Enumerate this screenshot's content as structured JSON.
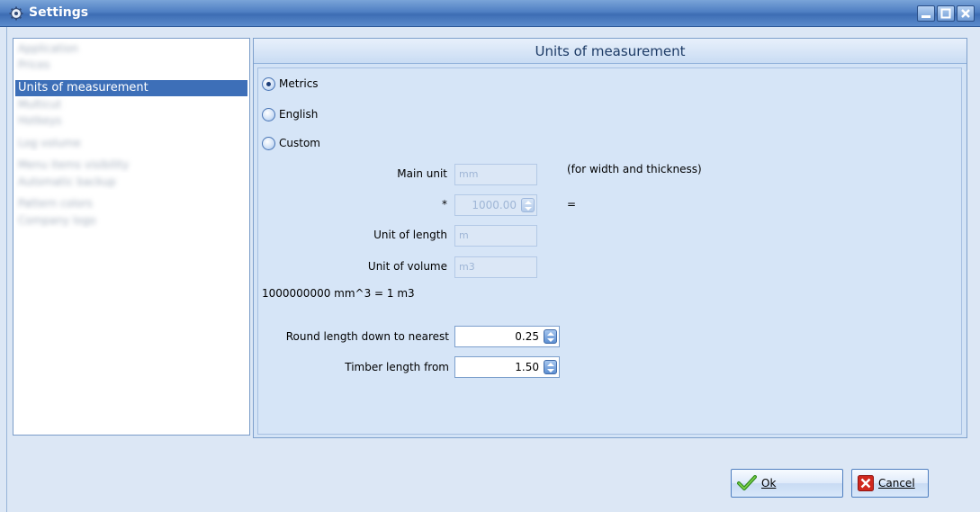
{
  "window": {
    "title": "Settings",
    "icon": "gear-icon",
    "controls": [
      "minimize-icon",
      "maximize-icon",
      "close-icon"
    ]
  },
  "nav": {
    "items": [
      {
        "label": "Application",
        "blurred": true
      },
      {
        "label": "Prices",
        "blurred": true
      },
      {
        "label": "Units of measurement",
        "selected": true
      },
      {
        "label": "Multicut",
        "blurred": true
      },
      {
        "label": "Hotkeys",
        "blurred": true
      },
      {
        "label": "Log volume",
        "blurred": true
      },
      {
        "label": "Menu items visibility",
        "blurred": true
      },
      {
        "label": "Automatic backup",
        "blurred": true
      },
      {
        "label": "Pattern colors",
        "blurred": true
      },
      {
        "label": "Company logo",
        "blurred": true
      }
    ]
  },
  "panel": {
    "header": "Units of measurement",
    "radios": [
      {
        "label": "Metrics",
        "checked": true
      },
      {
        "label": "English",
        "checked": false
      },
      {
        "label": "Custom",
        "checked": false
      }
    ],
    "main_unit_label": "Main unit",
    "main_unit_value": "mm",
    "main_unit_note": "(for width and thickness)",
    "multiplier_label": "*",
    "multiplier_value": "1000.00",
    "equals_label": "=",
    "length_unit_label": "Unit of length",
    "length_unit_value": "m",
    "volume_unit_label": "Unit of volume",
    "volume_unit_value": "m3",
    "conversion_text": "1000000000 mm^3 = 1 m3",
    "round_label": "Round length down to nearest",
    "round_value": "0.25",
    "timber_label": "Timber length from",
    "timber_value": "1.50"
  },
  "footer": {
    "ok_label": "Ok",
    "cancel_label": "Cancel",
    "ok_icon": "checkmark-icon",
    "cancel_icon": "cross-icon"
  },
  "colors": {
    "titlebar": "#4f7fc3",
    "selection": "#3d6fb8",
    "panel_bg": "#d6e5f7"
  }
}
